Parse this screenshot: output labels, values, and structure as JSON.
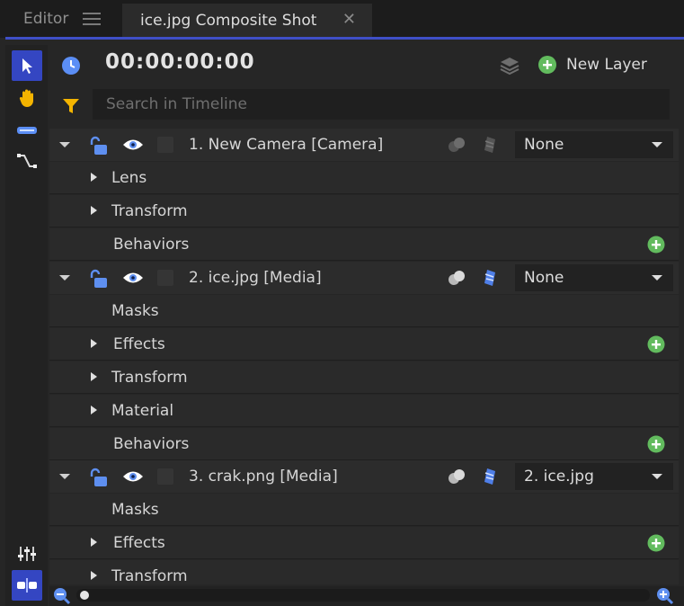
{
  "tabs": [
    {
      "label": "Editor"
    },
    {
      "label": "ice.jpg Composite Shot"
    }
  ],
  "timecode": "00:00:00:00",
  "new_layer_label": "New Layer",
  "search": {
    "placeholder": "Search in Timeline"
  },
  "layers": [
    {
      "name": "1. New Camera [Camera]",
      "parent": "None",
      "children": [
        {
          "label": "Lens",
          "expandable": true,
          "addable": false
        },
        {
          "label": "Transform",
          "expandable": true,
          "addable": false
        },
        {
          "label": "Behaviors",
          "expandable": false,
          "addable": true
        }
      ]
    },
    {
      "name": "2. ice.jpg [Media]",
      "parent": "None",
      "children": [
        {
          "label": "Masks",
          "expandable": false,
          "addable": false
        },
        {
          "label": "Effects",
          "expandable": true,
          "addable": true
        },
        {
          "label": "Transform",
          "expandable": true,
          "addable": false
        },
        {
          "label": "Material",
          "expandable": true,
          "addable": false
        },
        {
          "label": "Behaviors",
          "expandable": false,
          "addable": true
        }
      ]
    },
    {
      "name": "3. crak.png [Media]",
      "parent": "2. ice.jpg",
      "children": [
        {
          "label": "Masks",
          "expandable": false,
          "addable": false
        },
        {
          "label": "Effects",
          "expandable": true,
          "addable": true
        },
        {
          "label": "Transform",
          "expandable": true,
          "addable": false
        }
      ]
    }
  ],
  "colors": {
    "accent": "#3f4fc7",
    "add": "#62bb5e",
    "lock": "#5e8ff0",
    "tool_orange": "#f4b400"
  }
}
